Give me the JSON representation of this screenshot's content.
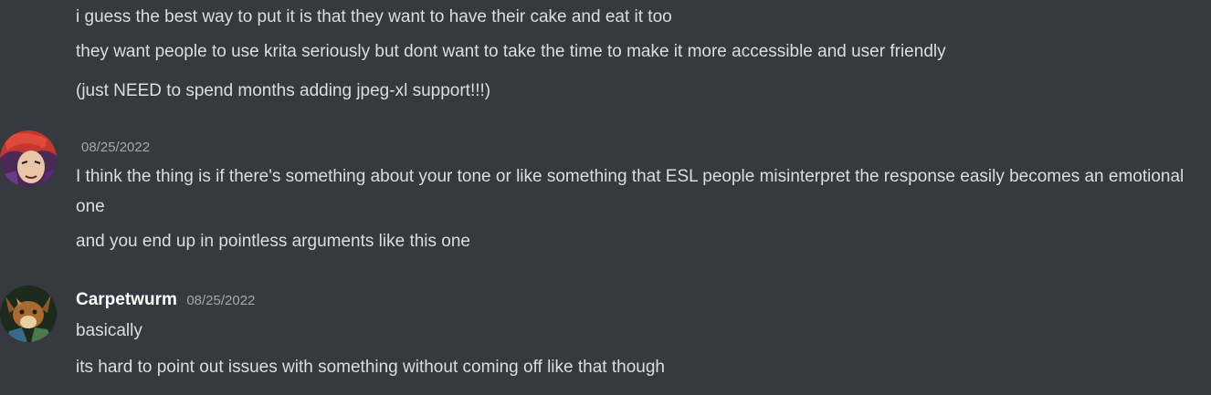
{
  "group1": {
    "lines": [
      "i guess the best way to put it is that they want to have their cake and eat it too",
      "they want people to use krita seriously but dont want to take the time to make it more accessible and user friendly",
      "(just NEED to spend months adding jpeg-xl support!!!)"
    ]
  },
  "message2": {
    "username": "",
    "timestamp": "08/25/2022",
    "text1": "I think the thing is if there's something about your tone or like something that ESL people misinterpret the response easily becomes an emotional one",
    "text2": "and you end up in pointless arguments like this one"
  },
  "message3": {
    "username": "Carpetwurm",
    "timestamp": "08/25/2022",
    "text1": "basically",
    "text2": "its hard to point out issues with something without coming off like that though"
  },
  "colors": {
    "background": "#36393f",
    "text": "#dcddde",
    "timestamp": "#a3a6aa",
    "username": "#ffffff"
  }
}
